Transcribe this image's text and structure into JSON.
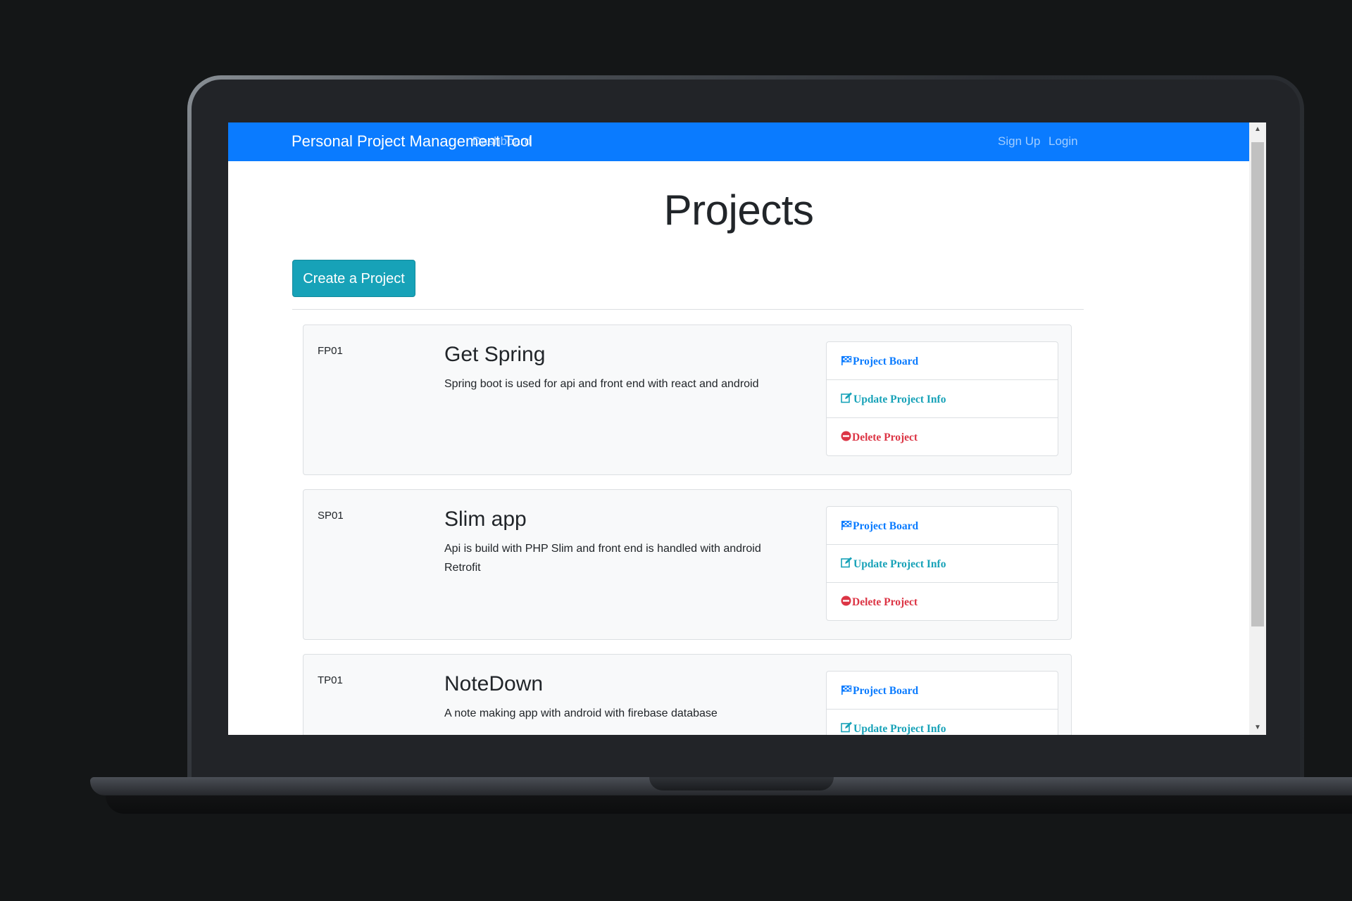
{
  "navbar": {
    "brand": "Personal Project Management Tool",
    "dashboard": "Dashboard",
    "sign_up": "Sign Up",
    "login": "Login"
  },
  "page": {
    "title": "Projects",
    "create_button": "Create a Project"
  },
  "actions": {
    "board_label": "Project Board",
    "update_label": "Update Project Info",
    "delete_label": "Delete Project"
  },
  "projects": [
    {
      "key": "FP01",
      "name": "Get Spring",
      "description": "Spring boot is used for api and front end with react and android"
    },
    {
      "key": "SP01",
      "name": "Slim app",
      "description": "Api is build with PHP Slim and front end is handled with android Retrofit"
    },
    {
      "key": "TP01",
      "name": "NoteDown",
      "description": "A note making app with android with firebase database"
    }
  ],
  "colors": {
    "navbar": "#0a7bff",
    "create_button": "#17a2b8",
    "board_link": "#0a7bff",
    "update_link": "#17a2b8",
    "delete_link": "#dc3545"
  },
  "icons": {
    "board": "flag-checkered-icon",
    "update": "edit-icon",
    "delete": "minus-circle-icon"
  }
}
